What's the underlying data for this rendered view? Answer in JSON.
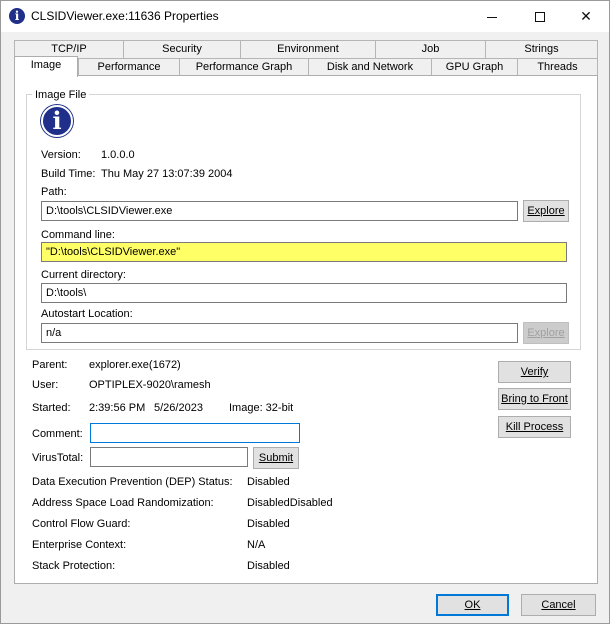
{
  "window": {
    "title": "CLSIDViewer.exe:11636 Properties",
    "minimize": "minimize",
    "maximize": "maximize",
    "close": "✕"
  },
  "tabs_row1": [
    "TCP/IP",
    "Security",
    "Environment",
    "Job",
    "Strings"
  ],
  "tabs_row2": [
    "Image",
    "Performance",
    "Performance Graph",
    "Disk and Network",
    "GPU Graph",
    "Threads"
  ],
  "active_tab": "Image",
  "image_file": {
    "group_label": "Image File",
    "version_label": "Version:",
    "version": "1.0.0.0",
    "build_time_label": "Build Time:",
    "build_time": "Thu May 27 13:07:39 2004",
    "path_label": "Path:",
    "path": "D:\\tools\\CLSIDViewer.exe",
    "explore_label": "Explore",
    "command_line_label": "Command line:",
    "command_line": "\"D:\\tools\\CLSIDViewer.exe\"",
    "current_dir_label": "Current directory:",
    "current_dir": "D:\\tools\\",
    "autostart_label": "Autostart Location:",
    "autostart": "n/a",
    "explore2_label": "Explore"
  },
  "process": {
    "parent_label": "Parent:",
    "parent": "explorer.exe(1672)",
    "user_label": "User:",
    "user": "OPTIPLEX-9020\\ramesh",
    "started_label": "Started:",
    "started_time": "2:39:56 PM",
    "started_date": "5/26/2023",
    "image_bits": "Image: 32-bit",
    "comment_label": "Comment:",
    "comment": "",
    "virustotal_label": "VirusTotal:",
    "virustotal": "",
    "submit_label": "Submit"
  },
  "buttons": {
    "verify": "Verify",
    "bring_to_front": "Bring to Front",
    "kill_process": "Kill Process",
    "ok": "OK",
    "cancel": "Cancel"
  },
  "security": [
    {
      "label": "Data Execution Prevention (DEP) Status:",
      "value": "Disabled"
    },
    {
      "label": "Address Space Load Randomization:",
      "value": "DisabledDisabled"
    },
    {
      "label": "Control Flow Guard:",
      "value": "Disabled"
    },
    {
      "label": "Enterprise Context:",
      "value": "N/A"
    },
    {
      "label": "Stack Protection:",
      "value": "Disabled"
    }
  ],
  "colors": {
    "highlight": "#ffff66",
    "accent": "#0078d7",
    "icon_blue": "#1f2f8a"
  }
}
